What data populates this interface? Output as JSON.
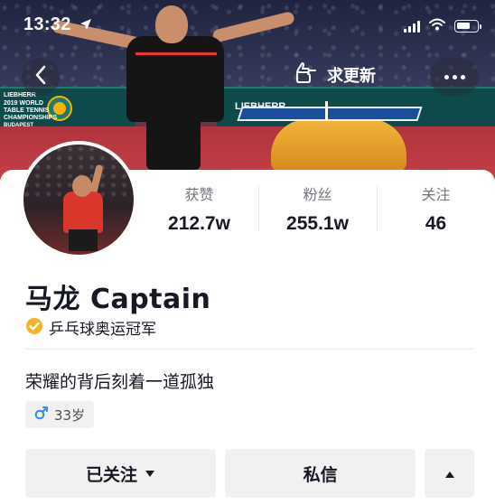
{
  "status_bar": {
    "time": "13:32"
  },
  "header": {
    "update_request_label": "求更新"
  },
  "profile": {
    "name": "马龙 Captain",
    "verification": "乒乓球奥运冠军",
    "signature": "荣耀的背后刻着一道孤独",
    "age_tag": "33岁",
    "gender_icon": "male-icon"
  },
  "stats": [
    {
      "label": "获赞",
      "value": "212.7w"
    },
    {
      "label": "粉丝",
      "value": "255.1w"
    },
    {
      "label": "关注",
      "value": "46"
    }
  ],
  "cover_text": {
    "ad_left_line1": "LIEBHERR",
    "ad_left_line2": "2019 WORLD",
    "ad_left_line3": "TABLE TENNIS",
    "ad_left_line4": "CHAMPIONSHIPS",
    "ad_left_line5": "BUDAPEST",
    "ad_right_brand": "LIEBHERR"
  },
  "actions": {
    "follow_label": "已关注",
    "message_label": "私信"
  },
  "colors": {
    "verify_badge": "#F5B32D",
    "gender_icon": "#2D8CF0",
    "button_bg": "#F1F1F2",
    "text_primary": "#161823",
    "text_secondary": "#75767D"
  }
}
